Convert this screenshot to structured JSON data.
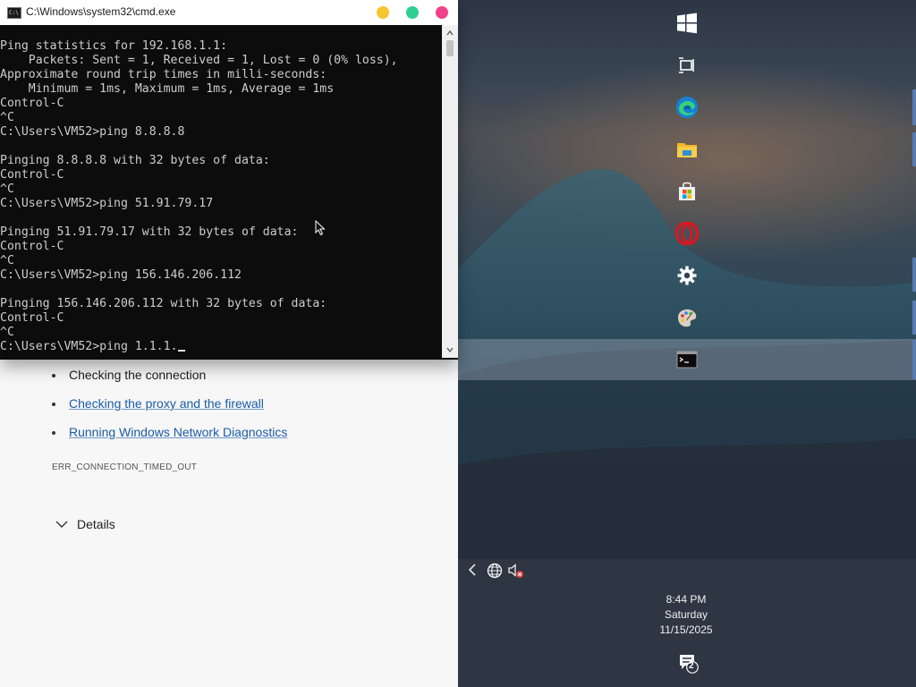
{
  "browser": {
    "list": [
      {
        "text": "Checking the connection",
        "link": false
      },
      {
        "text": "Checking the proxy and the firewall",
        "link": true
      },
      {
        "text": "Running Windows Network Diagnostics",
        "link": true
      }
    ],
    "error_code": "ERR_CONNECTION_TIMED_OUT",
    "details_label": "Details"
  },
  "cmd": {
    "title": "C:\\Windows\\system32\\cmd.exe",
    "icon_text": "C:\\",
    "lines": [
      "Ping statistics for 192.168.1.1:",
      "    Packets: Sent = 1, Received = 1, Lost = 0 (0% loss),",
      "Approximate round trip times in milli-seconds:",
      "    Minimum = 1ms, Maximum = 1ms, Average = 1ms",
      "Control-C",
      "^C",
      "C:\\Users\\VM52>ping 8.8.8.8",
      "",
      "Pinging 8.8.8.8 with 32 bytes of data:",
      "Control-C",
      "^C",
      "C:\\Users\\VM52>ping 51.91.79.17",
      "",
      "Pinging 51.91.79.17 with 32 bytes of data:",
      "Control-C",
      "^C",
      "C:\\Users\\VM52>ping 156.146.206.112",
      "",
      "Pinging 156.146.206.112 with 32 bytes of data:",
      "Control-C",
      "^C",
      "C:\\Users\\VM52>ping 1.1.1."
    ],
    "title_buttons": [
      {
        "name": "minimize",
        "color": "#f5c531"
      },
      {
        "name": "maximize",
        "color": "#2fcf94"
      },
      {
        "name": "close",
        "color": "#f0418a"
      }
    ]
  },
  "taskbar": {
    "icons": [
      "windows-start",
      "task-view",
      "edge",
      "file-explorer",
      "microsoft-store",
      "opera",
      "settings",
      "paint",
      "command-prompt"
    ],
    "active": "command-prompt"
  },
  "tray": {
    "icons": [
      "chevron-left",
      "network-globe",
      "volume-muted"
    ],
    "time": "8:44 PM",
    "day": "Saturday",
    "date": "11/15/2025",
    "notification_count": "2"
  }
}
